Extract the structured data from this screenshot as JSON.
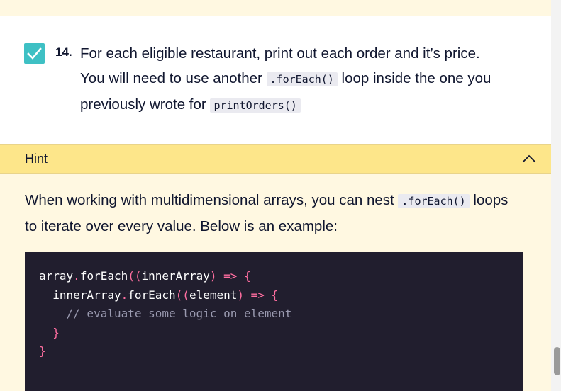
{
  "task": {
    "number": "14.",
    "line1": "For each eligible restaurant, print out each order and it’s price.",
    "line2_before": "You will need to use another ",
    "code1": ".forEach()",
    "line2_after": " loop inside the one you previously wrote for ",
    "code2": "printOrders()",
    "completed": true
  },
  "hint": {
    "label": "Hint",
    "text_before": "When working with multidimensional arrays, you can nest ",
    "code": ".forEach()",
    "text_after": " loops to iterate over every value. Below is an example:",
    "code_lines": {
      "l1a": "array",
      "l1b": ".",
      "l1c": "forEach",
      "l1d": "((",
      "l1e": "innerArray",
      "l1f": ")",
      "l1g": " => {",
      "l2a": "  innerArray",
      "l2b": ".",
      "l2c": "forEach",
      "l2d": "((",
      "l2e": "element",
      "l2f": ")",
      "l2g": " => {",
      "l3": "    // evaluate some logic on element",
      "l4": "  }",
      "l5": "}"
    }
  },
  "colors": {
    "checkbox": "#3ec0c4",
    "hint_header": "#fde68a",
    "hint_body": "#fff8e1",
    "code_bg": "#211e2e",
    "code_punct": "#ff6ea0"
  },
  "icons": {
    "check": "check-icon",
    "chevron": "chevron-up-icon"
  }
}
